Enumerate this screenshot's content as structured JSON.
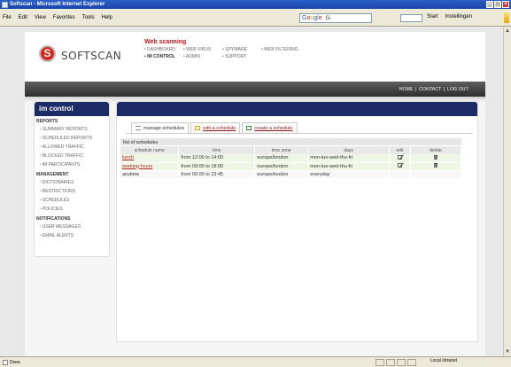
{
  "browser": {
    "title": "Softscan - Microsoft Internet Explorer",
    "menu": [
      "File",
      "Edit",
      "View",
      "Favorites",
      "Tools",
      "Help"
    ],
    "google_label": "Google",
    "google_suffix": "G-",
    "toolbar_right": [
      "Start",
      "Instellingen"
    ],
    "status_left": "Done",
    "status_zone": "Local intranet"
  },
  "app": {
    "logo_text": "SOFTSCAN",
    "nav_title": "Web scanning",
    "nav_links": [
      {
        "label": "DASHBOARD",
        "active": false
      },
      {
        "label": "WEB VIRUS",
        "active": false
      },
      {
        "label": "SPYWARE",
        "active": false
      },
      {
        "label": "WEB FILTERING",
        "active": false
      },
      {
        "label": "IM CONTROL",
        "active": true
      },
      {
        "label": "ADMIN",
        "active": false
      },
      {
        "label": "SUPPORT",
        "active": false
      }
    ],
    "top_links": [
      "HOME",
      "CONTACT",
      "LOG OUT"
    ]
  },
  "sidebar": {
    "title": "im control",
    "sections": [
      {
        "heading": "REPORTS",
        "items": [
          "SUMMARY REPORTS",
          "SCHEDULED REPORTS",
          "ALLOWED TRAFFIC",
          "BLOCKED TRAFFIC",
          "IM PARTICIPANTS"
        ]
      },
      {
        "heading": "MANAGEMENT",
        "items": [
          "DICTIONARIES",
          "RESTRICTIONS",
          "SCHEDULES",
          "POLICIES"
        ]
      },
      {
        "heading": "NOTIFICATIONS",
        "items": [
          "USER MESSAGES",
          "EMAIL ALERTS"
        ]
      }
    ]
  },
  "tabs": [
    {
      "label": "manage schedules",
      "type": "active"
    },
    {
      "label": "edit a schedule",
      "type": "link"
    },
    {
      "label": "create a schedule",
      "type": "link"
    }
  ],
  "schedules": {
    "title": "list of schedules",
    "columns": [
      "schedule name",
      "time",
      "time zone",
      "days",
      "edit",
      "delete"
    ],
    "rows": [
      {
        "name": "lunch",
        "linked": true,
        "time": "from 12:00 to 14:00",
        "zone": "europe/london",
        "days": "mon-tue-wed-thu-fri",
        "editable": true
      },
      {
        "name": "working hours",
        "linked": true,
        "time": "from 09:00 to 18:00",
        "zone": "europe/london",
        "days": "mon-tue-wed-thu-fri",
        "editable": true
      },
      {
        "name": "anytime",
        "linked": false,
        "time": "from 00:00 to 23:45",
        "zone": "europe/london",
        "days": "everyday",
        "editable": false
      }
    ]
  }
}
